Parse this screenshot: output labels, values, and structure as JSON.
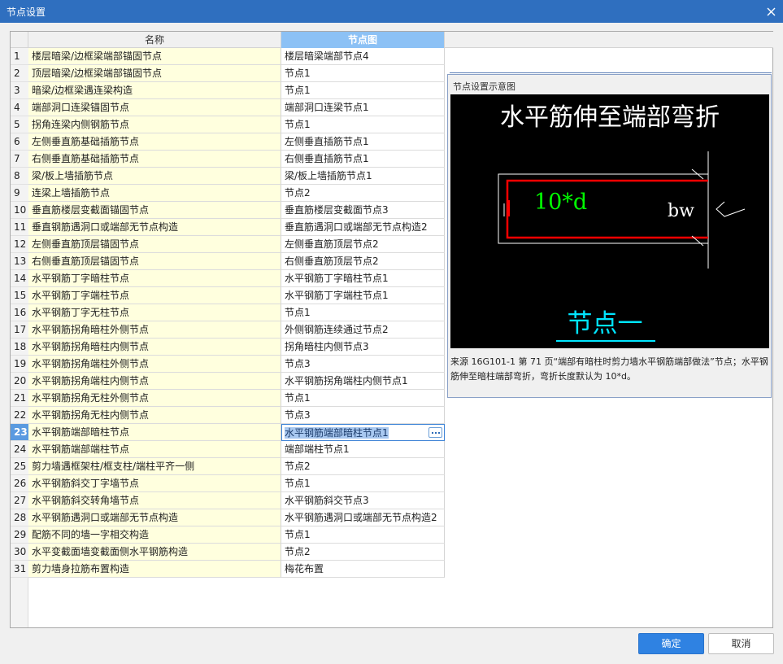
{
  "window": {
    "title": "节点设置"
  },
  "grid": {
    "headers": {
      "name": "名称",
      "node": "节点图"
    },
    "active_row": 23,
    "rows": [
      {
        "num": "1",
        "name": "楼层暗梁/边框梁端部锚固节点",
        "node": "楼层暗梁端部节点4"
      },
      {
        "num": "2",
        "name": "顶层暗梁/边框梁端部锚固节点",
        "node": "节点1"
      },
      {
        "num": "3",
        "name": "暗梁/边框梁遇连梁构造",
        "node": "节点1"
      },
      {
        "num": "4",
        "name": "端部洞口连梁锚固节点",
        "node": "端部洞口连梁节点1"
      },
      {
        "num": "5",
        "name": "拐角连梁内侧钢筋节点",
        "node": "节点1"
      },
      {
        "num": "6",
        "name": "左侧垂直筋基础插筋节点",
        "node": "左侧垂直插筋节点1"
      },
      {
        "num": "7",
        "name": "右侧垂直筋基础插筋节点",
        "node": "右侧垂直插筋节点1"
      },
      {
        "num": "8",
        "name": "梁/板上墙插筋节点",
        "node": "梁/板上墙插筋节点1"
      },
      {
        "num": "9",
        "name": "连梁上墙插筋节点",
        "node": "节点2"
      },
      {
        "num": "10",
        "name": "垂直筋楼层变截面锚固节点",
        "node": "垂直筋楼层变截面节点3"
      },
      {
        "num": "11",
        "name": "垂直钢筋遇洞口或端部无节点构造",
        "node": "垂直筋遇洞口或端部无节点构造2"
      },
      {
        "num": "12",
        "name": "左侧垂直筋顶层锚固节点",
        "node": "左侧垂直筋顶层节点2"
      },
      {
        "num": "13",
        "name": "右侧垂直筋顶层锚固节点",
        "node": "右侧垂直筋顶层节点2"
      },
      {
        "num": "14",
        "name": "水平钢筋丁字暗柱节点",
        "node": "水平钢筋丁字暗柱节点1"
      },
      {
        "num": "15",
        "name": "水平钢筋丁字端柱节点",
        "node": "水平钢筋丁字端柱节点1"
      },
      {
        "num": "16",
        "name": "水平钢筋丁字无柱节点",
        "node": "节点1"
      },
      {
        "num": "17",
        "name": "水平钢筋拐角暗柱外侧节点",
        "node": "外侧钢筋连续通过节点2"
      },
      {
        "num": "18",
        "name": "水平钢筋拐角暗柱内侧节点",
        "node": "拐角暗柱内侧节点3"
      },
      {
        "num": "19",
        "name": "水平钢筋拐角端柱外侧节点",
        "node": "节点3"
      },
      {
        "num": "20",
        "name": "水平钢筋拐角端柱内侧节点",
        "node": "水平钢筋拐角端柱内侧节点1"
      },
      {
        "num": "21",
        "name": "水平钢筋拐角无柱外侧节点",
        "node": "节点1"
      },
      {
        "num": "22",
        "name": "水平钢筋拐角无柱内侧节点",
        "node": "节点3"
      },
      {
        "num": "23",
        "name": "水平钢筋端部暗柱节点",
        "node": "水平钢筋端部暗柱节点1"
      },
      {
        "num": "24",
        "name": "水平钢筋端部端柱节点",
        "node": "端部端柱节点1"
      },
      {
        "num": "25",
        "name": "剪力墙遇框架柱/框支柱/端柱平齐一侧",
        "node": "节点2"
      },
      {
        "num": "26",
        "name": "水平钢筋斜交丁字墙节点",
        "node": "节点1"
      },
      {
        "num": "27",
        "name": "水平钢筋斜交转角墙节点",
        "node": "水平钢筋斜交节点3"
      },
      {
        "num": "28",
        "name": "水平钢筋遇洞口或端部无节点构造",
        "node": "水平钢筋遇洞口或端部无节点构造2"
      },
      {
        "num": "29",
        "name": "配筋不同的墙一字相交构造",
        "node": "节点1"
      },
      {
        "num": "30",
        "name": "水平变截面墙变截面侧水平钢筋构造",
        "node": "节点2"
      },
      {
        "num": "31",
        "name": "剪力墙身拉筋布置构造",
        "node": "梅花布置"
      }
    ]
  },
  "preview": {
    "title": "节点设置示意图",
    "diagram_heading": "水平筋伸至端部弯折",
    "label_length": "10*d",
    "label_bw": "bw",
    "caption": "节点一",
    "description": "来源 16G101-1 第 71 页“端部有暗柱时剪力墙水平钢筋端部做法”节点；水平钢筋伸至暗柱端部弯折，弯折长度默认为 10*d。"
  },
  "buttons": {
    "ok": "确定",
    "cancel": "取消"
  },
  "colors": {
    "titlebar": "#2f6fbf",
    "accent": "#2f82e2",
    "rebar": "#ff0000",
    "dim_text": "#00ff00",
    "caption": "#00e5ff"
  }
}
